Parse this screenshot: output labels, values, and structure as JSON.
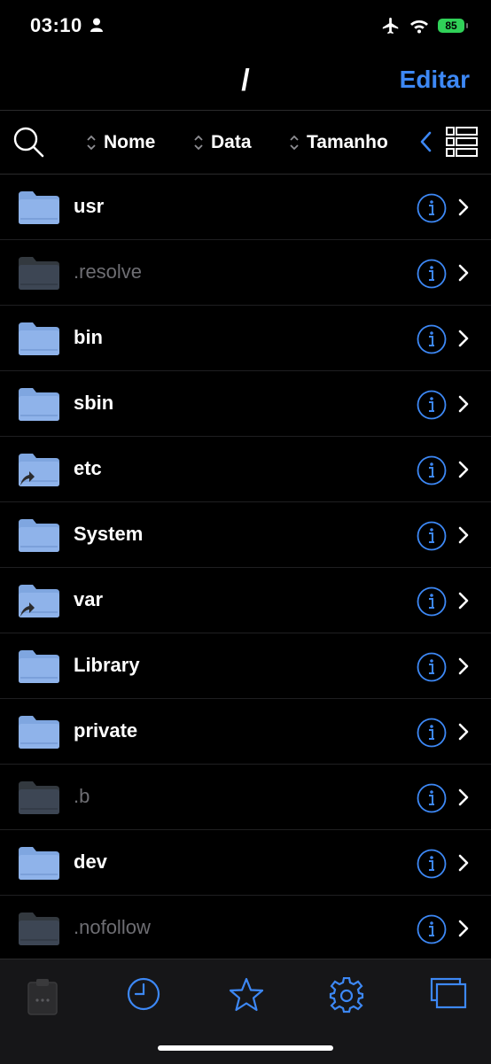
{
  "status": {
    "time": "03:10",
    "battery": "85"
  },
  "nav": {
    "title": "/",
    "edit_label": "Editar"
  },
  "sort": {
    "name_label": "Nome",
    "date_label": "Data",
    "size_label": "Tamanho"
  },
  "files": [
    {
      "name": "usr",
      "hidden": false,
      "symlink": false
    },
    {
      "name": ".resolve",
      "hidden": true,
      "symlink": false
    },
    {
      "name": "bin",
      "hidden": false,
      "symlink": false
    },
    {
      "name": "sbin",
      "hidden": false,
      "symlink": false
    },
    {
      "name": "etc",
      "hidden": false,
      "symlink": true
    },
    {
      "name": "System",
      "hidden": false,
      "symlink": false
    },
    {
      "name": "var",
      "hidden": false,
      "symlink": true
    },
    {
      "name": "Library",
      "hidden": false,
      "symlink": false
    },
    {
      "name": "private",
      "hidden": false,
      "symlink": false
    },
    {
      "name": ".b",
      "hidden": true,
      "symlink": false
    },
    {
      "name": "dev",
      "hidden": false,
      "symlink": false
    },
    {
      "name": ".nofollow",
      "hidden": true,
      "symlink": false
    }
  ],
  "tabs": [
    "clipboard-icon",
    "recents-clock-icon",
    "favorites-star-icon",
    "settings-gear-icon",
    "windows-icon"
  ],
  "colors": {
    "accent": "#3d88f5",
    "folder": "#7fa6e0",
    "folder_dim": "#3d4654",
    "battery": "#30d158"
  }
}
